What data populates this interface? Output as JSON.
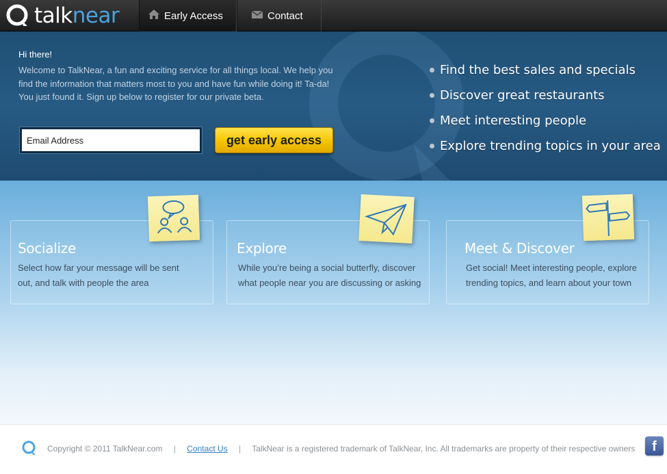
{
  "brand": {
    "name_part1": "talk",
    "name_part2": "near",
    "accent": "#4aa3e0"
  },
  "nav": {
    "items": [
      {
        "label": "Early Access",
        "icon": "home-icon",
        "active": true
      },
      {
        "label": "Contact",
        "icon": "envelope-icon",
        "active": false
      }
    ]
  },
  "hero": {
    "greeting": "Hi there!",
    "welcome": "Welcome to TalkNear, a fun and exciting service for all things local.  We help you find the information that matters most to you and have fun while doing it!  Ta-da!  You just found it.  Sign up below to register for our private beta.",
    "email_value": "Email Address",
    "cta_label": "get early access",
    "features": [
      "Find the best sales and specials",
      "Discover great restaurants",
      "Meet interesting people",
      "Explore trending topics in your area"
    ]
  },
  "cards": [
    {
      "title": "Socialize",
      "text_line1": "Select how far your message will be sent",
      "text_line2": "out, and talk with people the area",
      "icon": "people-chat-icon"
    },
    {
      "title": "Explore",
      "text_line1": "While you’re being a social butterfly, discover",
      "text_line2": "what people near you are discussing or asking",
      "icon": "paper-plane-icon"
    },
    {
      "title": "Meet & Discover",
      "text_line1": "Get social!  Meet interesting people, explore",
      "text_line2": "trending topics, and learn about your town",
      "icon": "signpost-icon"
    }
  ],
  "footer": {
    "copyright": "Copyright ©  2011 TalkNear.com",
    "sep": "|",
    "contact_link": "Contact Us",
    "trademark": "TalkNear is a registered trademark of TalkNear, Inc.  All trademarks are property of their respective owners",
    "facebook_glyph": "f"
  }
}
